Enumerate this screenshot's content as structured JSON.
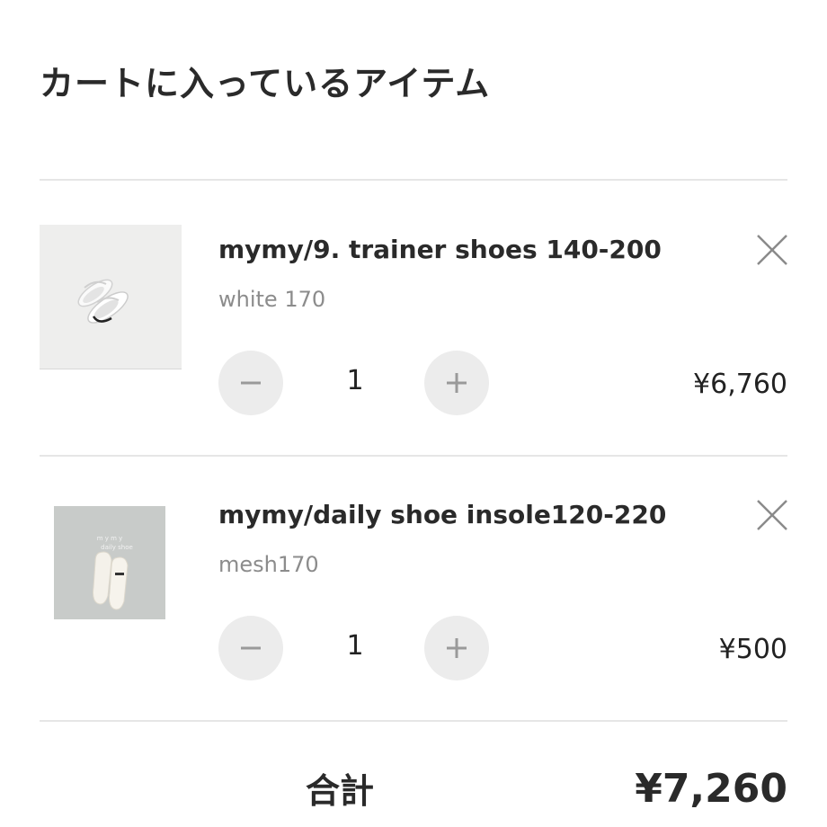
{
  "page": {
    "title": "カートに入っているアイテム"
  },
  "cart": {
    "items": [
      {
        "name": "mymy/9. trainer shoes 140-200",
        "variant": "white 170",
        "quantity": "1",
        "price": "¥6,760",
        "thumbnail_icon": "white-shoes-photo"
      },
      {
        "name": "mymy/daily shoe insole120-220",
        "variant": "mesh170",
        "quantity": "1",
        "price": "¥500",
        "thumbnail_icon": "insole-photo"
      }
    ],
    "icons": {
      "remove": "close-icon",
      "decrease": "minus-icon",
      "increase": "plus-icon"
    }
  },
  "summary": {
    "total_label": "合計",
    "total_value": "¥7,260"
  },
  "colors": {
    "qty_button_bg": "#ececec",
    "divider": "#e6e6e6",
    "variant_text": "#8c8c8c"
  }
}
